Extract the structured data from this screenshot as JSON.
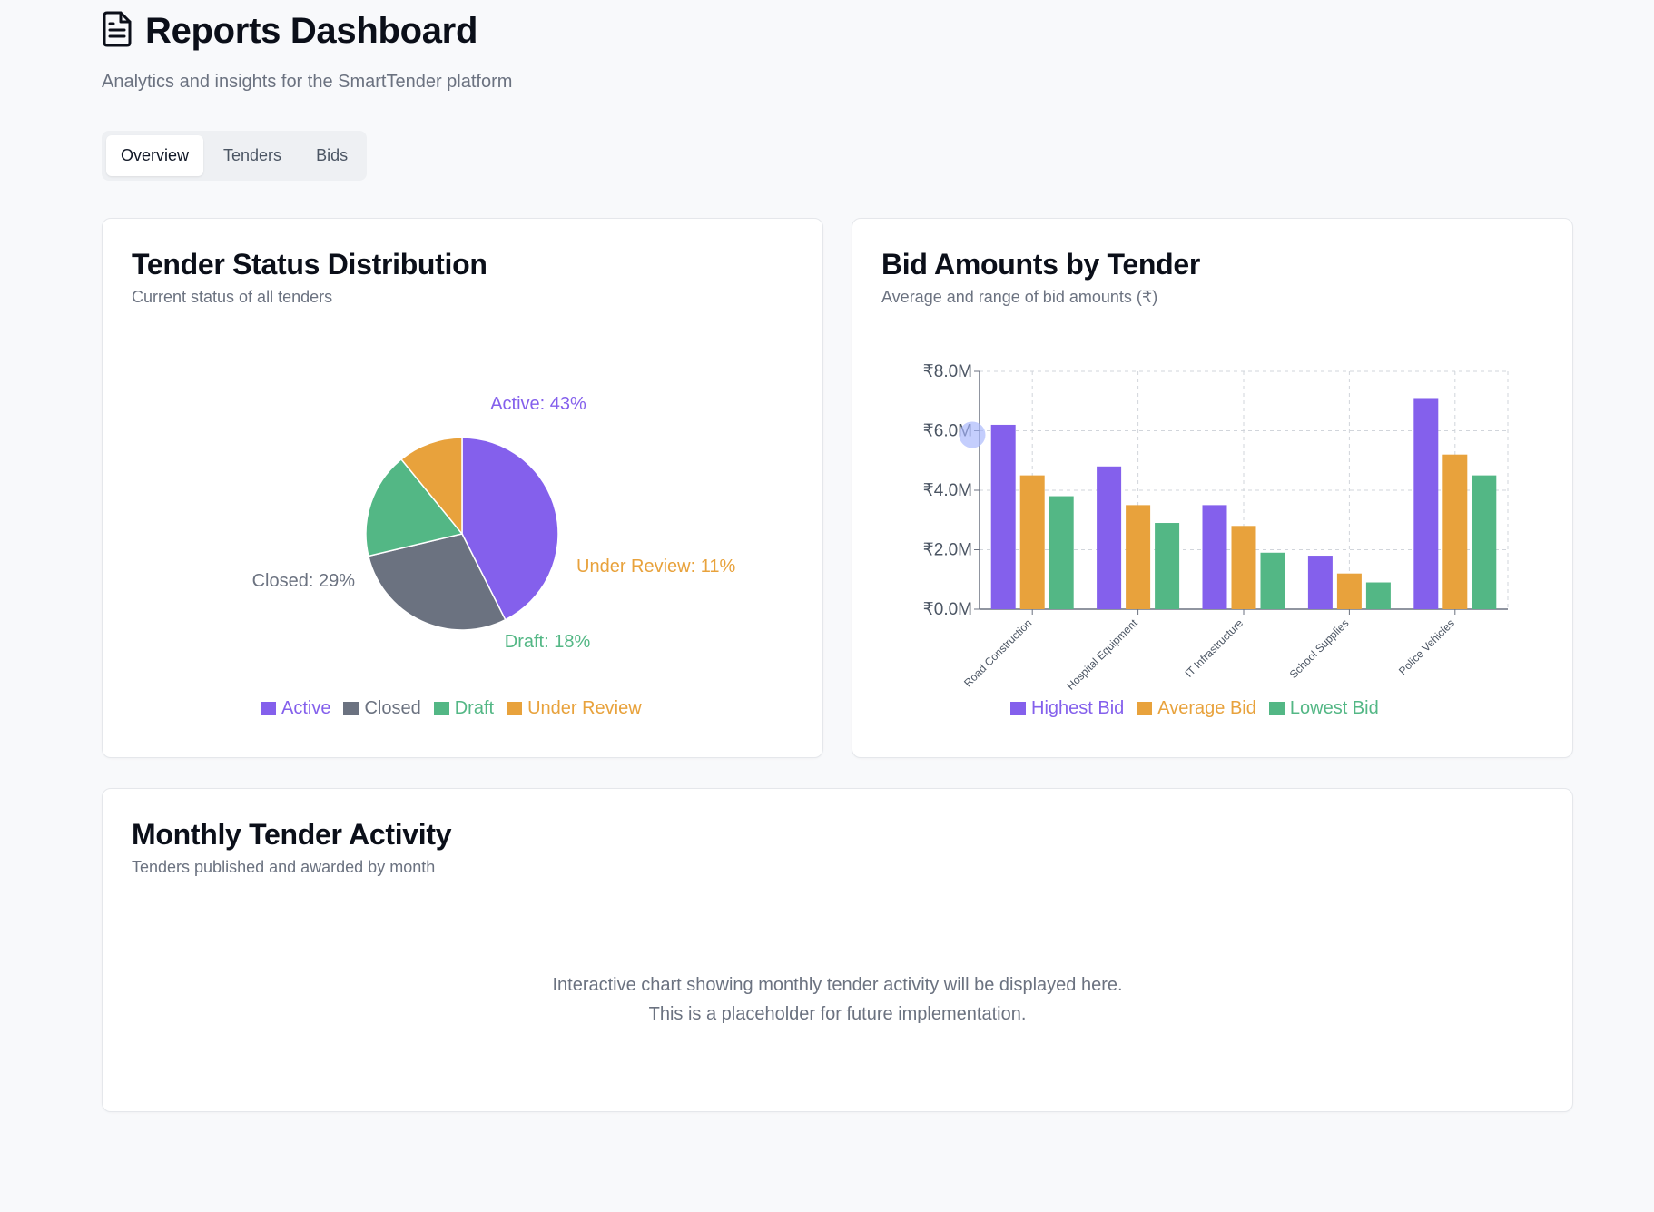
{
  "header": {
    "icon": "document-icon",
    "title": "Reports Dashboard",
    "subtitle": "Analytics and insights for the SmartTender platform"
  },
  "tabs": [
    {
      "label": "Overview",
      "active": true
    },
    {
      "label": "Tenders",
      "active": false
    },
    {
      "label": "Bids",
      "active": false
    }
  ],
  "status_card": {
    "title": "Tender Status Distribution",
    "description": "Current status of all tenders"
  },
  "bids_card": {
    "title": "Bid Amounts by Tender",
    "description": "Average and range of bid amounts (₹)"
  },
  "monthly_card": {
    "title": "Monthly Tender Activity",
    "description": "Tenders published and awarded by month",
    "placeholder_line1": "Interactive chart showing monthly tender activity will be displayed here.",
    "placeholder_line2": "This is a placeholder for future implementation."
  },
  "colors": {
    "active": "#8460ec",
    "closed": "#6b7280",
    "draft": "#53b785",
    "under_review": "#e8a23c"
  },
  "chart_data": [
    {
      "type": "pie",
      "categories": [
        "Active",
        "Closed",
        "Draft",
        "Under Review"
      ],
      "values": [
        43,
        29,
        18,
        11
      ],
      "slice_labels": [
        "Active: 43%",
        "Closed: 29%",
        "Draft: 18%",
        "Under Review: 11%"
      ],
      "colors": [
        "#8460ec",
        "#6b7280",
        "#53b785",
        "#e8a23c"
      ],
      "legend": "bottom"
    },
    {
      "type": "bar",
      "categories": [
        "Road Construction",
        "Hospital Equipment",
        "IT Infrastructure",
        "School Supplies",
        "Police Vehicles"
      ],
      "series": [
        {
          "name": "Highest Bid",
          "values": [
            6.2,
            4.8,
            3.5,
            1.8,
            7.1
          ],
          "color": "#8460ec"
        },
        {
          "name": "Average Bid",
          "values": [
            4.5,
            3.5,
            2.8,
            1.2,
            5.2
          ],
          "color": "#e8a23c"
        },
        {
          "name": "Lowest Bid",
          "values": [
            3.8,
            2.9,
            1.9,
            0.9,
            4.5
          ],
          "color": "#53b785"
        }
      ],
      "yticks": [
        "₹0.0M",
        "₹2.0M",
        "₹4.0M",
        "₹6.0M",
        "₹8.0M"
      ],
      "ylim": [
        0,
        8
      ],
      "grid": true,
      "legend": "bottom"
    }
  ]
}
